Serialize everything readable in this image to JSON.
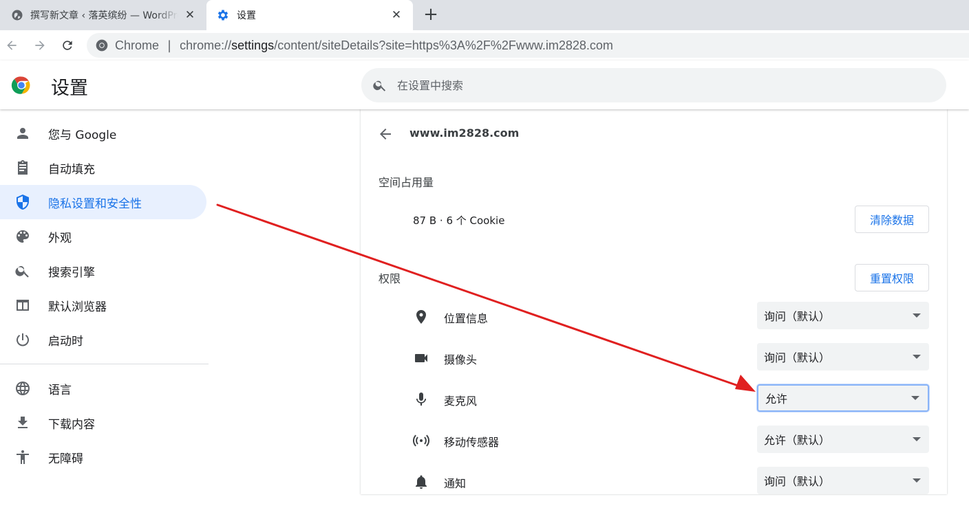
{
  "tabs": [
    {
      "title": "撰写新文章 ‹ 落英缤纷 — WordPress",
      "close": "✕"
    },
    {
      "title": "设置",
      "close": "✕"
    }
  ],
  "new_tab": "+",
  "omnibox": {
    "chip": "Chrome",
    "separator": "|",
    "url_prefix": "chrome://",
    "url_host": "settings",
    "url_path": "/content/siteDetails?site=https%3A%2F%2Fwww.im2828.com"
  },
  "header": {
    "title": "设置",
    "search_placeholder": "在设置中搜索"
  },
  "sidebar": {
    "items": [
      {
        "label": "您与 Google",
        "icon": "person-icon"
      },
      {
        "label": "自动填充",
        "icon": "clipboard-icon"
      },
      {
        "label": "隐私设置和安全性",
        "icon": "shield-icon",
        "active": true
      },
      {
        "label": "外观",
        "icon": "palette-icon"
      },
      {
        "label": "搜索引擎",
        "icon": "search-icon"
      },
      {
        "label": "默认浏览器",
        "icon": "browser-icon"
      },
      {
        "label": "启动时",
        "icon": "power-icon"
      },
      {
        "label": "语言",
        "icon": "globe-icon"
      },
      {
        "label": "下载内容",
        "icon": "download-icon"
      },
      {
        "label": "无障碍",
        "icon": "accessibility-icon"
      }
    ]
  },
  "site_details": {
    "site": "www.im2828.com",
    "usage_heading": "空间占用量",
    "usage_text": "87 B · 6 个 Cookie",
    "clear_button": "清除数据",
    "permissions_heading": "权限",
    "reset_button": "重置权限",
    "permissions": [
      {
        "label": "位置信息",
        "icon": "location-pin-icon",
        "value": "询问（默认）"
      },
      {
        "label": "摄像头",
        "icon": "camera-icon",
        "value": "询问（默认）"
      },
      {
        "label": "麦克风",
        "icon": "microphone-icon",
        "value": "允许",
        "focused": true
      },
      {
        "label": "移动传感器",
        "icon": "motion-sensor-icon",
        "value": "允许（默认）"
      },
      {
        "label": "通知",
        "icon": "bell-icon",
        "value": "询问（默认）"
      }
    ]
  },
  "colors": {
    "accent": "#1a73e8",
    "active_bg": "#e8f0fe",
    "annotation_arrow": "#e02020"
  }
}
